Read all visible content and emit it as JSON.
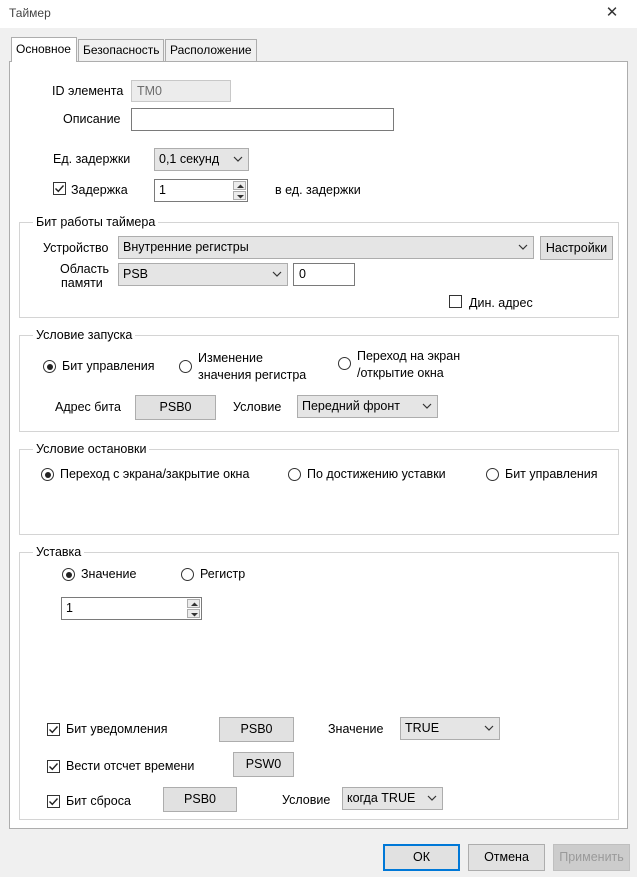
{
  "window": {
    "title": "Таймер"
  },
  "tabs": [
    "Основное",
    "Безопасность",
    "Расположение"
  ],
  "general": {
    "element_id_label": "ID элемента",
    "element_id_value": "TM0",
    "description_label": "Описание",
    "description_value": "",
    "delay_unit_label": "Ед. задержки",
    "delay_unit_value": "0,1 секунд",
    "delay_label": "Задержка",
    "delay_checked": true,
    "delay_value": "1",
    "delay_suffix": "в ед. задержки"
  },
  "timer_bit": {
    "title": "Бит работы таймера",
    "device_label": "Устройство",
    "device_value": "Внутренние регистры",
    "settings_button": "Настройки",
    "memory_label_line1": "Область",
    "memory_label_line2": "памяти",
    "memory_value": "PSB",
    "address_value": "0",
    "dyn_address_label": "Дин. адрес",
    "dyn_address_checked": false
  },
  "start_condition": {
    "title": "Условие запуска",
    "options": [
      {
        "label_line1": "Бит управления",
        "label_line2": "",
        "selected": true
      },
      {
        "label_line1": "Изменение",
        "label_line2": "значения регистра",
        "selected": false
      },
      {
        "label_line1": "Переход на экран",
        "label_line2": "/открытие окна",
        "selected": false
      }
    ],
    "bit_address_label": "Адрес бита",
    "bit_address_value": "PSB0",
    "condition_label": "Условие",
    "condition_value": "Передний фронт"
  },
  "stop_condition": {
    "title": "Условие остановки",
    "options": [
      {
        "label": "Переход с экрана/закрытие окна",
        "selected": true
      },
      {
        "label": "По достижению уставки",
        "selected": false
      },
      {
        "label": "Бит управления",
        "selected": false
      }
    ]
  },
  "setpoint": {
    "title": "Уставка",
    "options": [
      {
        "label": "Значение",
        "selected": true
      },
      {
        "label": "Регистр",
        "selected": false
      }
    ],
    "value": "1",
    "notify_label": "Бит уведомления",
    "notify_checked": true,
    "notify_address": "PSB0",
    "notify_value_label": "Значение",
    "notify_value": "TRUE",
    "timing_label": "Вести отсчет времени",
    "timing_checked": true,
    "timing_address": "PSW0",
    "reset_label": "Бит сброса",
    "reset_checked": true,
    "reset_address": "PSB0",
    "reset_condition_label": "Условие",
    "reset_condition_value": "когда TRUE"
  },
  "footer": {
    "ok": "ОК",
    "cancel": "Отмена",
    "apply": "Применить"
  }
}
